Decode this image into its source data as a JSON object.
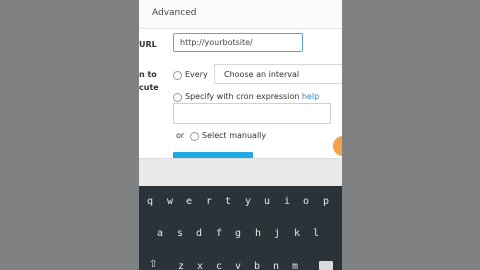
{
  "form": {
    "section_title": "Advanced",
    "url_label": "URL",
    "url_value": "http://yourbotsite/",
    "when_label_line1": "n to",
    "when_label_line2": "cute",
    "every_label": "Every",
    "interval_placeholder": "Choose an interval",
    "cron_label": "Specify with cron expression",
    "help_link": "help",
    "or_label": "or",
    "manual_label": "Select manually"
  },
  "keyboard": {
    "row1": [
      "q",
      "w",
      "e",
      "r",
      "t",
      "y",
      "u",
      "i",
      "o",
      "p"
    ],
    "row2": [
      "a",
      "s",
      "d",
      "f",
      "g",
      "h",
      "j",
      "k",
      "l"
    ],
    "shift_icon": "shift-icon",
    "backspace_icon": "backspace-icon"
  },
  "colors": {
    "accent": "#23a9e1",
    "link": "#2f7fd0",
    "keyboard_bg": "#2c3338",
    "orange": "#f6a04a"
  }
}
